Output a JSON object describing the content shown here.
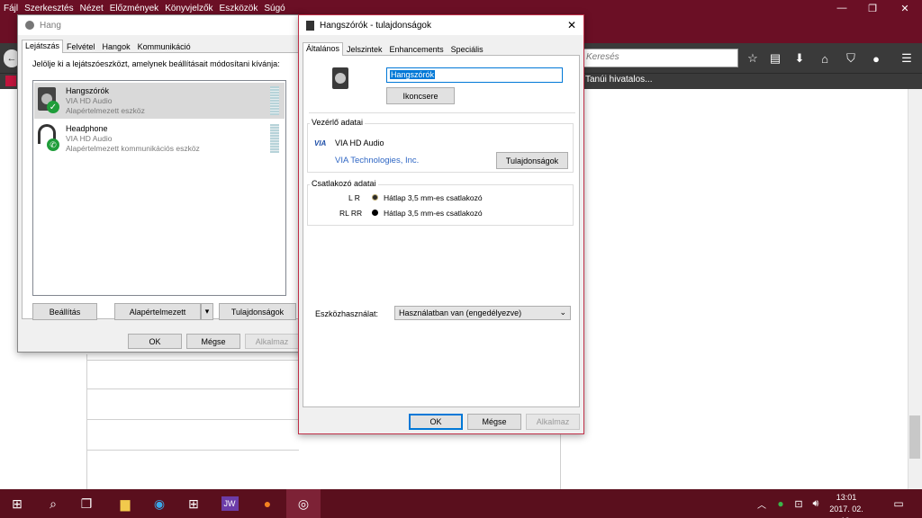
{
  "firefox": {
    "menu": [
      "Fájl",
      "Szerkesztés",
      "Nézet",
      "Előzmények",
      "Könyvjelzők",
      "Eszközök",
      "Súgó"
    ],
    "search_placeholder": "Keresés",
    "bookmark_text": "Tanúi hivatalos..."
  },
  "hang": {
    "title": "Hang",
    "tabs": [
      "Lejátszás",
      "Felvétel",
      "Hangok",
      "Kommunikáció"
    ],
    "instruction": "Jelölje ki a lejátszóeszközt, amelynek beállításait módosítani kívánja:",
    "devices": [
      {
        "name": "Hangszórók",
        "driver": "VIA HD Audio",
        "status": "Alapértelmezett eszköz"
      },
      {
        "name": "Headphone",
        "driver": "VIA HD Audio",
        "status": "Alapértelmezett kommunikációs eszköz"
      }
    ],
    "buttons": {
      "configure": "Beállítás",
      "default": "Alapértelmezett",
      "properties": "Tulajdonságok",
      "ok": "OK",
      "cancel": "Mégse",
      "apply": "Alkalmaz"
    }
  },
  "props": {
    "title": "Hangszórók - tulajdonságok",
    "tabs": [
      "Általános",
      "Jelszintek",
      "Enhancements",
      "Speciális"
    ],
    "name_value": "Hangszórók",
    "change_icon": "Ikoncsere",
    "controller_label": "Vezérlő adatai",
    "controller_name": "VIA HD Audio",
    "controller_vendor": "VIA Technologies, Inc.",
    "controller_properties": "Tulajdonságok",
    "jack_label": "Csatlakozó adatai",
    "jacks": [
      {
        "channel": "L R",
        "desc": "Hátlap 3,5 mm-es csatlakozó",
        "color": "#2a2a2a"
      },
      {
        "channel": "RL RR",
        "desc": "Hátlap 3,5 mm-es csatlakozó",
        "color": "#000000"
      }
    ],
    "usage_label": "Eszközhasználat:",
    "usage_value": "Használatban van (engedélyezve)",
    "buttons": {
      "ok": "OK",
      "cancel": "Mégse",
      "apply": "Alkalmaz"
    }
  },
  "taskbar": {
    "time": "13:01",
    "date": "2017. 02. 19.",
    "jw_label": "JW"
  },
  "colors": {
    "accent": "#0078d7",
    "taskbar": "#5a0f1d",
    "menubar": "#6b0f25"
  }
}
